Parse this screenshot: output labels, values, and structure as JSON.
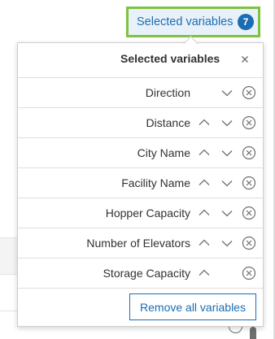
{
  "trigger": {
    "label": "Selected variables",
    "count": "7"
  },
  "popover": {
    "title": "Selected variables",
    "remove_all_label": "Remove all variables",
    "variables": [
      {
        "label": "Direction",
        "up": false,
        "down": true
      },
      {
        "label": "Distance",
        "up": true,
        "down": true
      },
      {
        "label": "City Name",
        "up": true,
        "down": true
      },
      {
        "label": "Facility Name",
        "up": true,
        "down": true
      },
      {
        "label": "Hopper Capacity",
        "up": true,
        "down": true
      },
      {
        "label": "Number of Elevators",
        "up": true,
        "down": true
      },
      {
        "label": "Storage Capacity",
        "up": true,
        "down": false
      }
    ]
  },
  "icons": {
    "close": "close-icon",
    "move_up": "chevron-up-icon",
    "move_down": "chevron-down-icon",
    "remove": "x-circle-icon",
    "info": "info-icon"
  },
  "colors": {
    "accent": "#1a6db4",
    "highlight_border": "#7fc241",
    "trigger_bg": "#e8f1f9",
    "text": "#323232",
    "icon": "#6e6e6e"
  }
}
